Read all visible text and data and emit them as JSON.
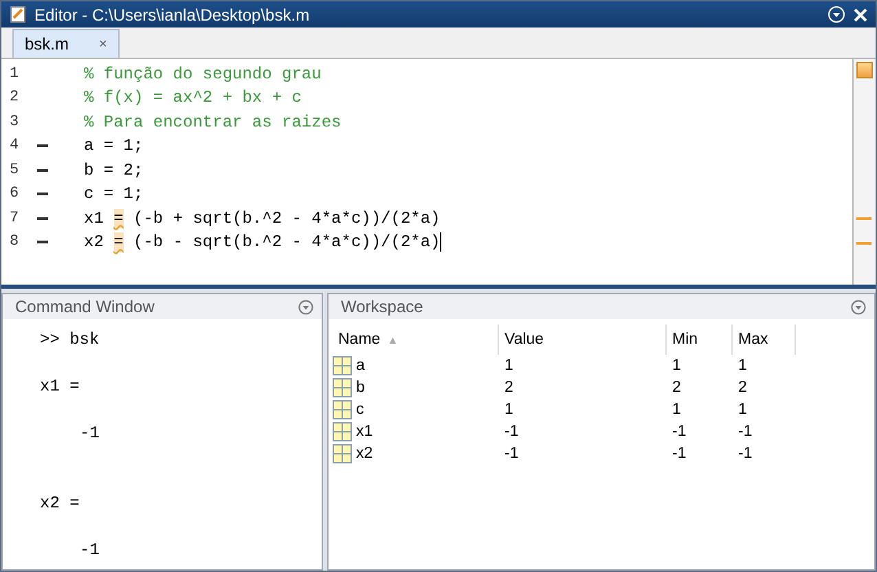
{
  "window": {
    "title": "Editor - C:\\Users\\ianla\\Desktop\\bsk.m"
  },
  "tabs": [
    {
      "label": "bsk.m",
      "close": "×",
      "selected": true
    }
  ],
  "editor": {
    "warning": true,
    "lines": [
      {
        "number": "1",
        "executable": false,
        "kind": "comment",
        "segments": [
          {
            "text": "% função do segundo grau",
            "flagged": false
          }
        ]
      },
      {
        "number": "2",
        "executable": false,
        "kind": "comment",
        "segments": [
          {
            "text": "% f(x) = ax^2 + bx + c",
            "flagged": false
          }
        ]
      },
      {
        "number": "3",
        "executable": false,
        "kind": "comment",
        "segments": [
          {
            "text": "% Para encontrar as raizes",
            "flagged": false
          }
        ]
      },
      {
        "number": "4",
        "executable": true,
        "kind": "code",
        "segments": [
          {
            "text": "a = 1;",
            "flagged": false
          }
        ]
      },
      {
        "number": "5",
        "executable": true,
        "kind": "code",
        "segments": [
          {
            "text": "b = 2;",
            "flagged": false
          }
        ]
      },
      {
        "number": "6",
        "executable": true,
        "kind": "code",
        "segments": [
          {
            "text": "c = 1;",
            "flagged": false
          }
        ]
      },
      {
        "number": "7",
        "executable": true,
        "kind": "code",
        "segments": [
          {
            "text": "x1 ",
            "flagged": false
          },
          {
            "text": "=",
            "flagged": true
          },
          {
            "text": " (-b + sqrt(b.^2 - 4*a*c))/(2*a)",
            "flagged": false
          }
        ]
      },
      {
        "number": "8",
        "executable": true,
        "kind": "code",
        "cursor": true,
        "segments": [
          {
            "text": "x2 ",
            "flagged": false
          },
          {
            "text": "=",
            "flagged": true
          },
          {
            "text": " (-b - sqrt(b.^2 - 4*a*c))/(2*a)",
            "flagged": false
          }
        ]
      }
    ]
  },
  "command_window": {
    "title": "Command Window",
    "lines": [
      {
        "kind": "prompt",
        "text": ">> bsk"
      },
      {
        "kind": "variable",
        "text": "x1 ="
      },
      {
        "kind": "value",
        "text": "-1"
      },
      {
        "kind": "variable",
        "text": "x2 ="
      },
      {
        "kind": "value",
        "text": "-1"
      }
    ]
  },
  "workspace": {
    "title": "Workspace",
    "columns": [
      {
        "label": "Name",
        "sort": "▲"
      },
      {
        "label": "Value"
      },
      {
        "label": "Min"
      },
      {
        "label": "Max"
      }
    ],
    "rows": [
      [
        "a",
        "1",
        "1",
        "1"
      ],
      [
        "b",
        "2",
        "2",
        "2"
      ],
      [
        "c",
        "1",
        "1",
        "1"
      ],
      [
        "x1",
        "-1",
        "-1",
        "-1"
      ],
      [
        "x2",
        "-1",
        "-1",
        "-1"
      ]
    ]
  }
}
